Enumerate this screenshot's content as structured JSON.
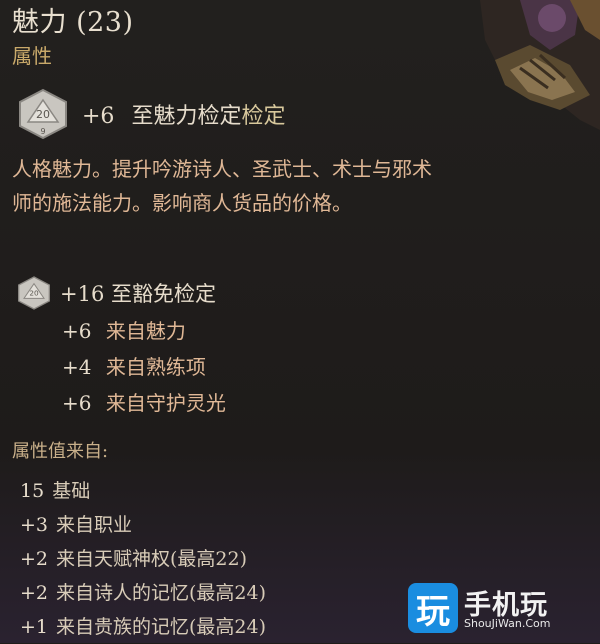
{
  "tooltip": {
    "title": "魅力 (23)",
    "subtitle": "属性",
    "ability_check": {
      "die_label": "20",
      "die_sub": "9",
      "bonus": "+6",
      "text_prefix": "至魅力检定",
      "text_suffix": "检定"
    },
    "description": "人格魅力。提升吟游诗人、圣武士、术士与邪术师的施法能力。影响商人货品的价格。",
    "saving_throw": {
      "die_label": "20",
      "label": "+16 至豁免检定",
      "breakdown": [
        {
          "value": "+6",
          "source": "来自魅力"
        },
        {
          "value": "+4",
          "source": "来自熟练项"
        },
        {
          "value": "+6",
          "source": "来自守护灵光"
        }
      ]
    },
    "sources_heading": "属性值来自:",
    "sources": [
      {
        "value": "15",
        "source": "基础"
      },
      {
        "value": "+3",
        "source": "来自职业"
      },
      {
        "value": "+2",
        "source": "来自天赋神权(最高22)"
      },
      {
        "value": "+2",
        "source": "来自诗人的记忆(最高24)"
      },
      {
        "value": "+1",
        "source": "来自贵族的记忆(最高24)"
      }
    ]
  },
  "watermark": {
    "logo_char": "玩",
    "name": "手机玩",
    "url": "ShouJiWan.Com"
  },
  "colors": {
    "background": "#1f1c1a",
    "subtitle": "#c9a96a",
    "description": "#e0b896",
    "watermark_blue": "#1a8de0"
  }
}
